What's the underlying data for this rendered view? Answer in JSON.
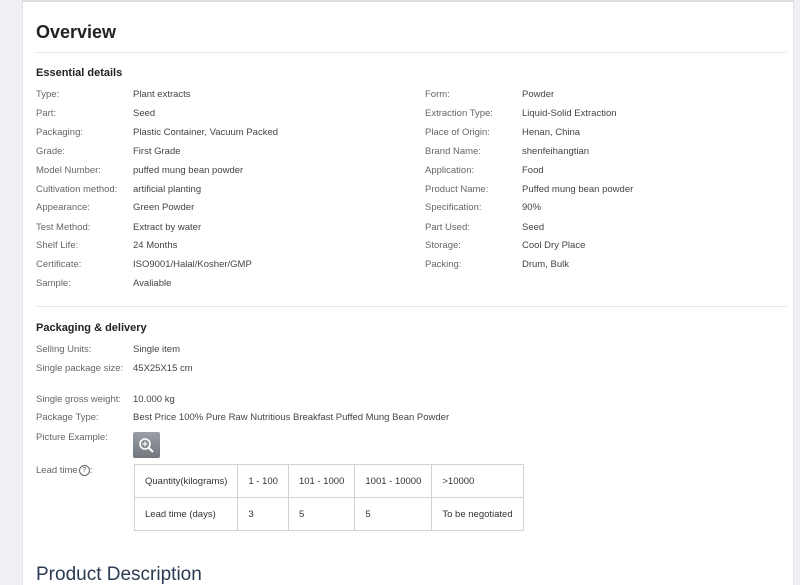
{
  "overview_title": "Overview",
  "essential": {
    "heading": "Essential details",
    "left": [
      {
        "label": "Type:",
        "value": "Plant extracts"
      },
      {
        "label": "Part:",
        "value": "Seed"
      },
      {
        "label": "Packaging:",
        "value": "Plastic Container, Vacuum Packed"
      },
      {
        "label": "Grade:",
        "value": "First Grade"
      },
      {
        "label": "Model Number:",
        "value": "puffed mung bean powder"
      },
      {
        "label": "Cultivation method:",
        "value": "artificial planting"
      },
      {
        "label": "Appearance:",
        "value": "Green Powder"
      },
      {
        "label": "Test Method:",
        "value": "Extract by water"
      },
      {
        "label": "Shelf Life:",
        "value": "24 Months"
      },
      {
        "label": "Certificate:",
        "value": "ISO9001/Halal/Kosher/GMP"
      },
      {
        "label": "Sample:",
        "value": "Avaliable"
      }
    ],
    "right": [
      {
        "label": "Form:",
        "value": "Powder"
      },
      {
        "label": "Extraction Type:",
        "value": "Liquid-Solid Extraction"
      },
      {
        "label": "Place of Origin:",
        "value": "Henan, China"
      },
      {
        "label": "Brand Name:",
        "value": "shenfeihangtian"
      },
      {
        "label": "Application:",
        "value": "Food"
      },
      {
        "label": "Product Name:",
        "value": "Puffed mung bean powder"
      },
      {
        "label": "Specification:",
        "value": "90%"
      },
      {
        "label": "Part Used:",
        "value": "Seed"
      },
      {
        "label": "Storage:",
        "value": "Cool Dry Place"
      },
      {
        "label": "Packing:",
        "value": "Drum, Bulk"
      }
    ]
  },
  "packaging": {
    "heading": "Packaging & delivery",
    "selling_units_label": "Selling Units:",
    "selling_units": "Single item",
    "package_size_label": "Single package size:",
    "package_size": "45X25X15 cm",
    "gross_weight_label": "Single gross weight:",
    "gross_weight": "10.000 kg",
    "package_type_label": "Package Type:",
    "package_type": "Best Price 100% Pure Raw Nutritious Breakfast Puffed Mung Bean Powder",
    "picture_example_label": "Picture Example:",
    "lead_time_label": "Lead time",
    "lead_time_help": "?",
    "lead_table": {
      "header": [
        "Quantity(kilograms)",
        "1 - 100",
        "101 - 1000",
        "1001 - 10000",
        ">10000"
      ],
      "row": [
        "Lead time (days)",
        "3",
        "5",
        "5",
        "To be negotiated"
      ]
    }
  },
  "product_description_title": "Product Description"
}
